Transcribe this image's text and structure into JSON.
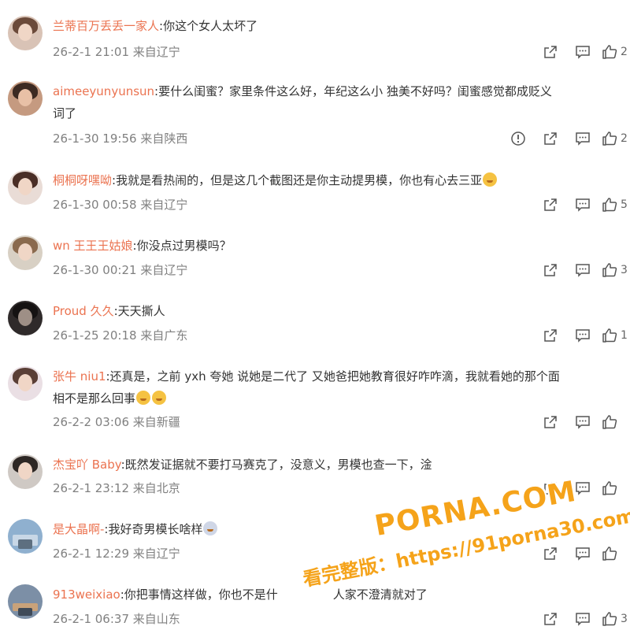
{
  "icons": {
    "share": "share-icon",
    "comment": "comment-icon",
    "like": "thumbs-up-icon",
    "report": "report-icon"
  },
  "colors": {
    "username": "#eb7350",
    "meta": "#808080",
    "watermark": "#f5a31a"
  },
  "comments": [
    {
      "username": "兰蒂百万丢丢一家人",
      "text": ":你这个女人太坏了",
      "time": "26-2-1 21:01",
      "location": "来自辽宁",
      "likes": "2"
    },
    {
      "username": "aimeeyunyunsun",
      "text": ":要什么闺蜜？家里条件这么好，年纪这么小 独美不好吗？闺蜜感觉都成贬义",
      "text2": "词了",
      "time": "26-1-30 19:56",
      "location": "来自陕西",
      "likes": "2"
    },
    {
      "username": "桐桐呀嘿呦",
      "text": ":我就是看热闹的，但是这几个截图还是你主动提男模，你也有心去三亚",
      "time": "26-1-30 00:58",
      "location": "来自辽宁",
      "likes": "5"
    },
    {
      "username": "wn 王王王姑娘",
      "text": ":你没点过男模吗？",
      "time": "26-1-30 00:21",
      "location": "来自辽宁",
      "likes": "3"
    },
    {
      "username": "Proud 久久",
      "text": ":天天撕人",
      "time": "26-1-25 20:18",
      "location": "来自广东",
      "likes": "1"
    },
    {
      "username": "张牛 niu1",
      "text": ":还真是，之前 yxh 夸她 说她是二代了 又她爸把她教育很好咋咋滴，我就看她的那个面",
      "text2": "相不是那么回事",
      "time": "26-2-2 03:06",
      "location": "来自新疆",
      "likes": ""
    },
    {
      "username": "杰宝吖 Baby",
      "text": ":既然发证据就不要打马赛克了，没意义，男模也查一下，淦",
      "time": "26-2-1 23:12",
      "location": "来自北京",
      "likes": ""
    },
    {
      "username": "是大晶啊-",
      "text": ":我好奇男模长啥样",
      "time": "26-2-1 12:29",
      "location": "来自辽宁",
      "likes": ""
    },
    {
      "username": "913weixiao",
      "text": ":你把事情这样做，你也不是什",
      "text_after": "人家不澄清就对了",
      "time": "26-2-1 06:37",
      "location": "来自山东",
      "likes": "3"
    }
  ],
  "watermark": {
    "brand": "PORNA.COM",
    "url_text": "看完整版：https://91porna30.com"
  }
}
